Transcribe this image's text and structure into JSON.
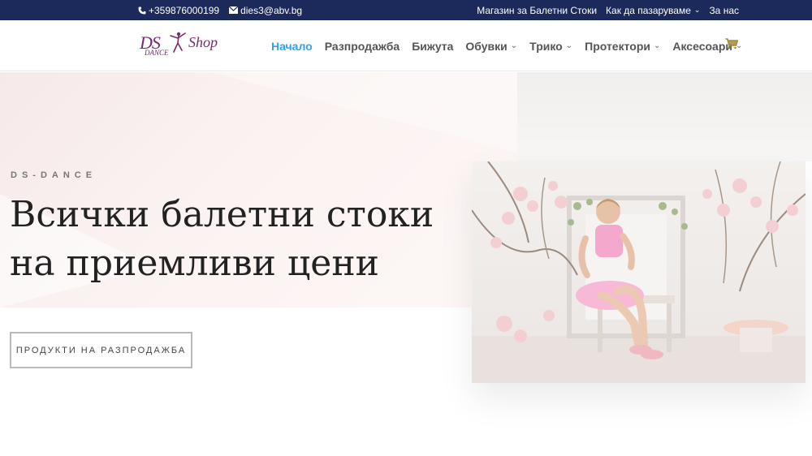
{
  "topbar": {
    "phone": "+359876000199",
    "email": "dies3@abv.bg",
    "links": [
      {
        "label": "Магазин за Балетни Стоки",
        "has_dropdown": false
      },
      {
        "label": "Как да пазаруваме",
        "has_dropdown": true
      },
      {
        "label": "За нас",
        "has_dropdown": false
      }
    ]
  },
  "logo": {
    "ds": "DS",
    "dance": "DANCE",
    "shop": "Shop"
  },
  "nav": {
    "items": [
      {
        "label": "Начало",
        "active": true,
        "has_dropdown": false
      },
      {
        "label": "Разпродажба",
        "active": false,
        "has_dropdown": false
      },
      {
        "label": "Бижута",
        "active": false,
        "has_dropdown": false
      },
      {
        "label": "Обувки",
        "active": false,
        "has_dropdown": true
      },
      {
        "label": "Трико",
        "active": false,
        "has_dropdown": true
      },
      {
        "label": "Протектори",
        "active": false,
        "has_dropdown": true
      },
      {
        "label": "Аксесоари",
        "active": false,
        "has_dropdown": true
      }
    ],
    "cart_icon": "cart-icon"
  },
  "hero": {
    "eyebrow": "DS-DANCE",
    "headline_line1": "Всички балетни стоки",
    "headline_line2": "на приемливи цени",
    "cta_label": "ПРОДУКТИ НА РАЗПРОДАЖБА"
  },
  "colors": {
    "topbar_bg": "#1b2a5a",
    "nav_active": "#2ea3f2",
    "logo": "#7a2a6c",
    "cart": "#a38a3a"
  }
}
